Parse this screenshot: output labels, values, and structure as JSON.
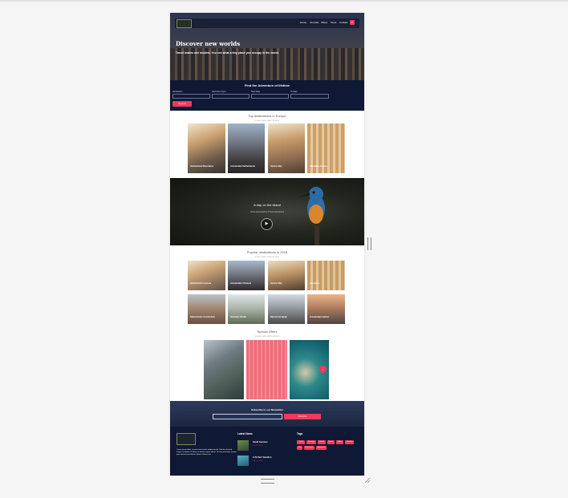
{
  "nav": {
    "items": [
      "Home",
      "Journals",
      "Offers",
      "Tours",
      "Contact"
    ],
    "search_icon": "search-icon"
  },
  "hero": {
    "title": "Discover new worlds",
    "subtitle": "Travel makes one modest. You see what a tiny place you occupy in the world."
  },
  "search": {
    "title": "Find the Adventure of lifetime",
    "fields": [
      {
        "label": "Destination"
      },
      {
        "label": "Adventure Type"
      },
      {
        "label": "Start Date"
      },
      {
        "label": "To Date"
      }
    ],
    "button": "Search"
  },
  "europe": {
    "title": "Top destinations in Europe",
    "subtitle": "Lorem ipsum dolor sit amet",
    "cards": [
      {
        "caption": "Switzerland Mountains"
      },
      {
        "caption": "Amsterdam Netherlands"
      },
      {
        "caption": "Venice Italy"
      },
      {
        "caption": "Versailles France"
      }
    ]
  },
  "video": {
    "title": "A day on the island",
    "subtitle": "Video presented by Travel Adventures"
  },
  "popular": {
    "title": "Popular destinations in 2018",
    "subtitle": "Lorem ipsum dolor sit amet",
    "cards": [
      {
        "caption": "Switzerland Lucerne"
      },
      {
        "caption": "Amsterdam Channel"
      },
      {
        "caption": "Venice Italy"
      },
      {
        "caption": "Versailles"
      },
      {
        "caption": "Netherlands Amsterdam"
      },
      {
        "caption": "Germany Berlin"
      },
      {
        "caption": "Barcelona Spain"
      },
      {
        "caption": "Amsterdam Harbor"
      }
    ]
  },
  "offers": {
    "title": "Special Offers",
    "subtitle": "Lorem ipsum dolor sit amet"
  },
  "newsletter": {
    "title": "Subscribe to our Newsletter",
    "button": "Subscribe"
  },
  "footer": {
    "about": "Lorem ipsum dolor sit amet consectetur adipiscing elit. Sed do eiusmod tempor incididunt ut labore et dolore magna aliqua. Ut enim ad minim veniam quis nostrud exercitation ullamco laboris nisi.",
    "news_heading": "Latest News",
    "news": [
      {
        "title": "Small Summer",
        "date": "Jan 18, 2018"
      },
      {
        "title": "A Perfect Vacation",
        "date": "Jan 14, 2018"
      }
    ],
    "tags_heading": "Tags",
    "tags": [
      "Travel",
      "Journeys",
      "Islands",
      "Beach",
      "Offers",
      "Vacation",
      "City",
      "City Tours",
      "Adventure"
    ]
  },
  "colors": {
    "accent": "#f2395a",
    "dark": "#0f1835"
  }
}
